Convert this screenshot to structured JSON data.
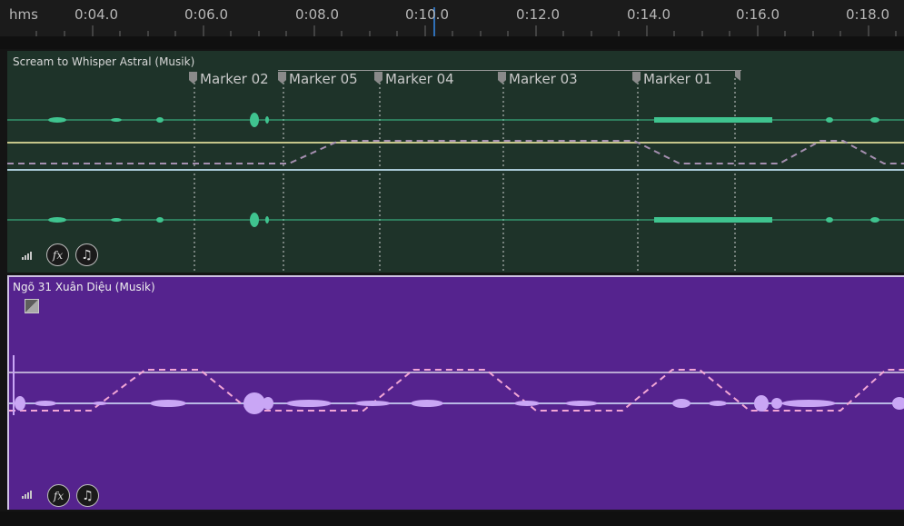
{
  "ruler": {
    "unit": "hms",
    "labels": [
      "0:04.0",
      "0:06.0",
      "0:08.0",
      "0:10.0",
      "0:12.0",
      "0:14.0",
      "0:16.0",
      "0:18.0"
    ]
  },
  "track1": {
    "title": "Scream to Whisper Astral (Musik)",
    "color": "#1e3329",
    "wave_color": "#3fc48f",
    "markers": [
      "Marker 02",
      "Marker 05",
      "Marker 04",
      "Marker 03",
      "Marker 01"
    ],
    "fx_label": "fx",
    "send_label": "♫"
  },
  "track2": {
    "title": "Ngõ 31 Xuân Diệu (Musik)",
    "color": "#55238e",
    "wave_color": "#c9a6f5",
    "fx_label": "fx",
    "send_label": "♫"
  },
  "playhead_color": "#2f6fb7"
}
